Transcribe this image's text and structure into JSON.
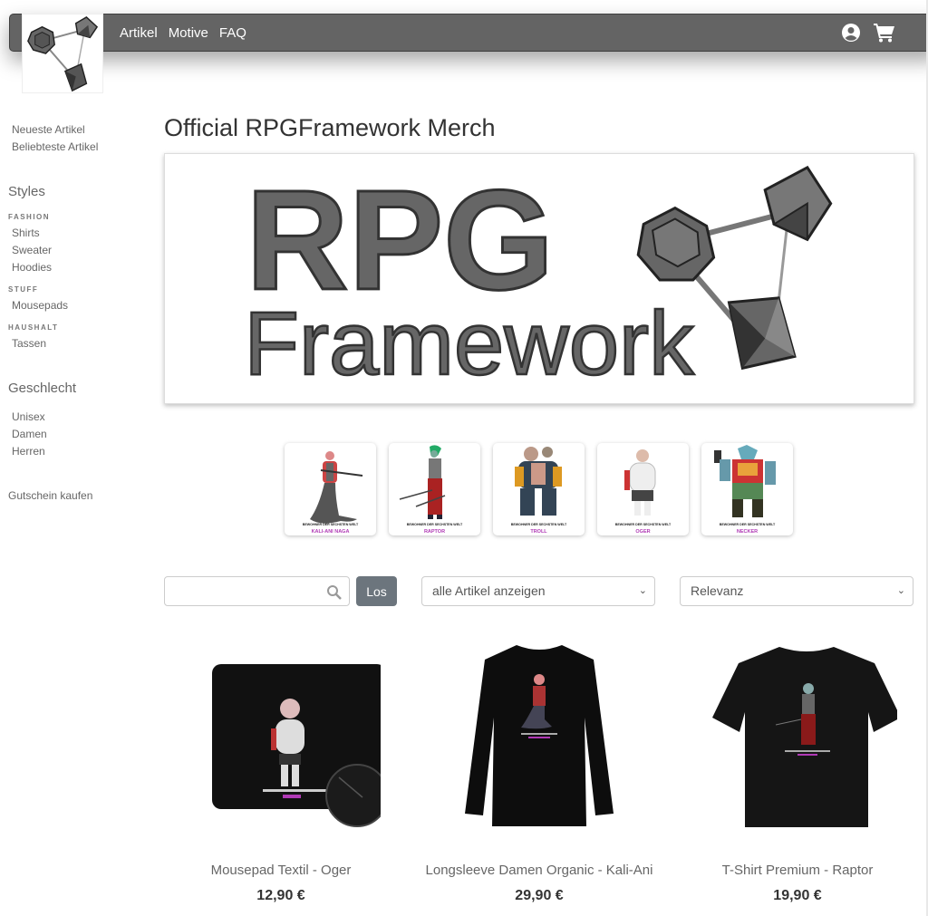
{
  "nav": {
    "links": [
      "Artikel",
      "Motive",
      "FAQ"
    ],
    "icons": [
      "user-account-icon",
      "shopping-cart-icon"
    ]
  },
  "sidebar": {
    "top_links": [
      "Neueste Artikel",
      "Beliebteste Artikel"
    ],
    "styles_heading": "Styles",
    "categories": [
      {
        "name": "FASHION",
        "items": [
          "Shirts",
          "Sweater",
          "Hoodies"
        ]
      },
      {
        "name": "STUFF",
        "items": [
          "Mousepads"
        ]
      },
      {
        "name": "HAUSHALT",
        "items": [
          "Tassen"
        ]
      }
    ],
    "gender_heading": "Geschlecht",
    "genders": [
      "Unisex",
      "Damen",
      "Herren"
    ],
    "gift": "Gutschein kaufen"
  },
  "main": {
    "title": "Official RPGFramework Merch",
    "banner": {
      "line1": "RPG",
      "line2": "Framework"
    },
    "motifs": [
      {
        "caption": "BEWOHNER DER SECHSTEN WELT",
        "name": "KALI-ANI NAGA"
      },
      {
        "caption": "BEWOHNER DER SECHSTEN WELT",
        "name": "RAPTOR"
      },
      {
        "caption": "BEWOHNER DER SECHSTEN WELT",
        "name": "TROLL"
      },
      {
        "caption": "BEWOHNER DER SECHSTEN WELT",
        "name": "OGER"
      },
      {
        "caption": "BEWOHNER DER SECHSTEN WELT",
        "name": "NECKER"
      }
    ],
    "search": {
      "placeholder": "",
      "value": "",
      "button": "Los"
    },
    "filter_select": "alle Artikel anzeigen",
    "sort_select": "Relevanz",
    "products": [
      {
        "name": "Mousepad Textil - Oger",
        "price": "12,90 €"
      },
      {
        "name": "Longsleeve Damen Organic - Kali-Ani",
        "price": "29,90 €"
      },
      {
        "name": "T-Shirt Premium - Raptor",
        "price": "19,90 €"
      }
    ]
  }
}
